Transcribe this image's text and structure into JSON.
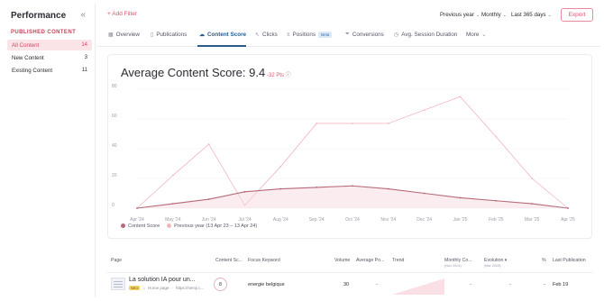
{
  "sidebar": {
    "title": "Performance",
    "collapse_icon": "double-chevron-left-icon",
    "section": "PUBLISHED CONTENT",
    "items": [
      {
        "label": "All Content",
        "count": "14",
        "active": true
      },
      {
        "label": "New Content",
        "count": "3",
        "active": false
      },
      {
        "label": "Existing Content",
        "count": "11",
        "active": false
      }
    ]
  },
  "topbar": {
    "add_filter": "+ Add Filter",
    "compare": "Previous year",
    "granularity": "Monthly",
    "range": "Last 365 days",
    "export": "Export"
  },
  "tabs": [
    {
      "label": "Overview",
      "icon": "grid-icon"
    },
    {
      "label": "Publications",
      "icon": "document-icon"
    },
    {
      "label": "Content Score",
      "icon": "cloud-icon",
      "active": true
    },
    {
      "label": "Clicks",
      "icon": "cursor-icon"
    },
    {
      "label": "Positions",
      "icon": "list-icon",
      "badge": "Beta"
    },
    {
      "label": "Conversions",
      "icon": "funnel-icon"
    },
    {
      "label": "Avg. Session Duration",
      "icon": "clock-icon"
    },
    {
      "label": "More",
      "icon": "chevron-down-icon"
    }
  ],
  "chart_header": {
    "title": "Average Content Score: 9.4",
    "delta": "-32 Pts"
  },
  "chart_data": {
    "type": "line",
    "categories": [
      "Apr '24",
      "May '24",
      "Jun '24",
      "Jul '24",
      "Aug '24",
      "Sep '24",
      "Oct '24",
      "Nov '24",
      "Dec '24",
      "Jan '25",
      "Feb '25",
      "Mar '25",
      "Apr '25"
    ],
    "series": [
      {
        "name": "Content Score",
        "color": "#b56a78",
        "values": [
          0,
          3,
          6,
          11,
          13,
          14,
          15,
          13,
          10,
          7,
          5,
          3,
          0
        ]
      },
      {
        "name": "Previous year (13 Apr 23 – 13 Apr 24)",
        "color": "#f2b6c1",
        "values": [
          0,
          22,
          43,
          2,
          28,
          57,
          57,
          57,
          66,
          75,
          48,
          20,
          0
        ]
      }
    ],
    "ylim": [
      0,
      80
    ],
    "yticks": [
      "0",
      "20",
      "40",
      "60",
      "80"
    ],
    "grid": true,
    "legend": "bottom-left"
  },
  "table": {
    "headers": [
      {
        "label": "Page"
      },
      {
        "label": "Content Sc..."
      },
      {
        "label": "Focus Keyword"
      },
      {
        "label": "Volume"
      },
      {
        "label": "Average Po..."
      },
      {
        "label": "Trend"
      },
      {
        "label": "Monthly Co...",
        "sub": "(Nov 2024)"
      },
      {
        "label": "Evolution",
        "sub": "(Mar 2025)"
      },
      {
        "label": "%"
      },
      {
        "label": "Last Publication"
      }
    ],
    "rows": [
      {
        "title": "La solution IA pour un...",
        "tag": "SEO",
        "home": "Home page",
        "url": "https://semji.c...",
        "score": "8",
        "keyword": "energie belgique",
        "volume": "30",
        "avg_pos": "-",
        "monthly": "-",
        "evolution": "-",
        "pct": "-",
        "last_pub": "Feb 19"
      }
    ]
  }
}
